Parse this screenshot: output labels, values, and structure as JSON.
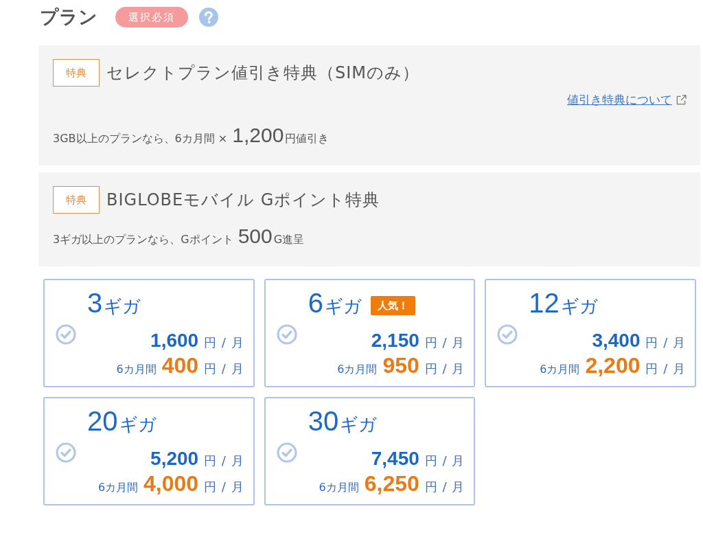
{
  "section": {
    "title": "プラン",
    "required_badge": "選択必須"
  },
  "benefits": [
    {
      "tag": "特典",
      "title": "セレクトプラン値引き特典（SIMのみ）",
      "link": "値引き特典について",
      "description": "3GB以上のプランなら、6カ月間 × **1,200**円値引き"
    },
    {
      "tag": "特典",
      "title": "BIGLOBEモバイル Gポイント特典",
      "description": "3ギガ以上のプランなら、Gポイント **500**G進呈"
    }
  ],
  "plans": [
    {
      "amount": "3",
      "unit": "ギガ",
      "price": "1,600",
      "price_unit": "円 / 月",
      "promo_label": "6カ月間",
      "promo_price": "400",
      "promo_unit": "円 / 月",
      "selected": false
    },
    {
      "amount": "6",
      "unit": "ギガ",
      "badge": "人気！",
      "price": "2,150",
      "price_unit": "円 / 月",
      "promo_label": "6カ月間",
      "promo_price": "950",
      "promo_unit": "円 / 月",
      "selected": false
    },
    {
      "amount": "12",
      "unit": "ギガ",
      "price": "3,400",
      "price_unit": "円 / 月",
      "promo_label": "6カ月間",
      "promo_price": "2,200",
      "promo_unit": "円 / 月",
      "selected": false
    },
    {
      "amount": "20",
      "unit": "ギガ",
      "price": "5,200",
      "price_unit": "円 / 月",
      "promo_label": "6カ月間",
      "promo_price": "4,000",
      "promo_unit": "円 / 月",
      "selected": false
    },
    {
      "amount": "30",
      "unit": "ギガ",
      "price": "7,450",
      "price_unit": "円 / 月",
      "promo_label": "6カ月間",
      "promo_price": "6,250",
      "promo_unit": "円 / 月",
      "selected": false
    }
  ]
}
